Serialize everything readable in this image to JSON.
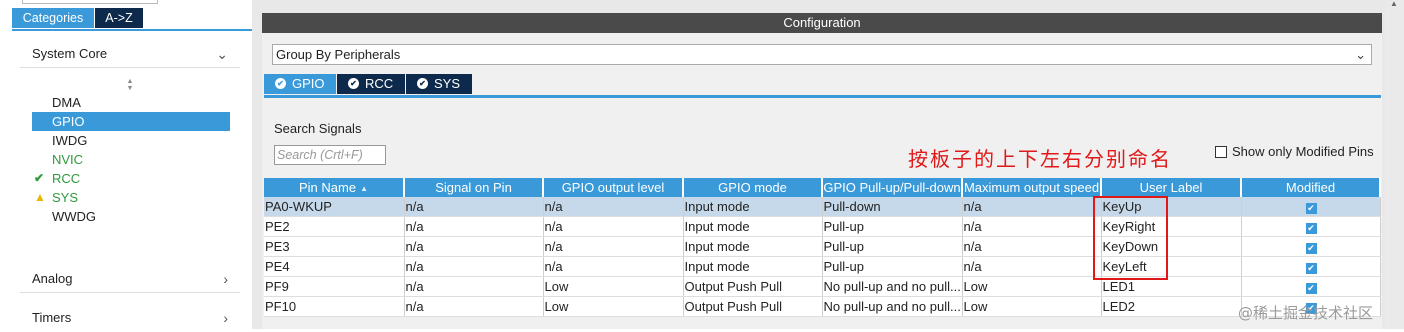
{
  "left_panel": {
    "tabs": [
      {
        "label": "Categories",
        "active": true
      },
      {
        "label": "A->Z",
        "active": false
      }
    ],
    "sections": {
      "system_core": {
        "title": "System Core",
        "chevron": "chevron-down-icon"
      },
      "analog": {
        "title": "Analog",
        "chevron": "chevron-right-icon"
      },
      "timers": {
        "title": "Timers",
        "chevron": "chevron-right-icon"
      }
    },
    "items": [
      {
        "label": "DMA",
        "state": "normal"
      },
      {
        "label": "GPIO",
        "state": "selected"
      },
      {
        "label": "IWDG",
        "state": "normal"
      },
      {
        "label": "NVIC",
        "state": "configured"
      },
      {
        "label": "RCC",
        "state": "ok",
        "icon": "check-icon"
      },
      {
        "label": "SYS",
        "state": "warning",
        "icon": "warning-icon"
      },
      {
        "label": "WWDG",
        "state": "normal"
      }
    ]
  },
  "config": {
    "title": "Configuration",
    "group_select": "Group By Peripherals",
    "tabs": [
      {
        "label": "GPIO",
        "active": true
      },
      {
        "label": "RCC",
        "active": false
      },
      {
        "label": "SYS",
        "active": false
      }
    ],
    "search_label": "Search Signals",
    "search_placeholder": "Search (Crtl+F)",
    "annotation": "按板子的上下左右分别命名",
    "show_modified_label": "Show only Modified Pins"
  },
  "table": {
    "columns": [
      "Pin Name",
      "Signal on Pin",
      "GPIO output level",
      "GPIO mode",
      "GPIO Pull-up/Pull-down",
      "Maximum output speed",
      "User Label",
      "Modified"
    ],
    "rows": [
      [
        "PA0-WKUP",
        "n/a",
        "n/a",
        "Input mode",
        "Pull-down",
        "n/a",
        "KeyUp",
        true
      ],
      [
        "PE2",
        "n/a",
        "n/a",
        "Input mode",
        "Pull-up",
        "n/a",
        "KeyRight",
        true
      ],
      [
        "PE3",
        "n/a",
        "n/a",
        "Input mode",
        "Pull-up",
        "n/a",
        "KeyDown",
        true
      ],
      [
        "PE4",
        "n/a",
        "n/a",
        "Input mode",
        "Pull-up",
        "n/a",
        "KeyLeft",
        true
      ],
      [
        "PF9",
        "n/a",
        "Low",
        "Output Push Pull",
        "No pull-up and no pull...",
        "Low",
        "LED1",
        true
      ],
      [
        "PF10",
        "n/a",
        "Low",
        "Output Push Pull",
        "No pull-up and no pull...",
        "Low",
        "LED2",
        true
      ]
    ],
    "selected_row": 0
  },
  "watermark": "@稀土掘金技术社区",
  "colors": {
    "accent": "#3a9ad9",
    "dark_tab": "#0d2a4c",
    "annotation": "#e01818",
    "configured_green": "#2e9a3e"
  }
}
